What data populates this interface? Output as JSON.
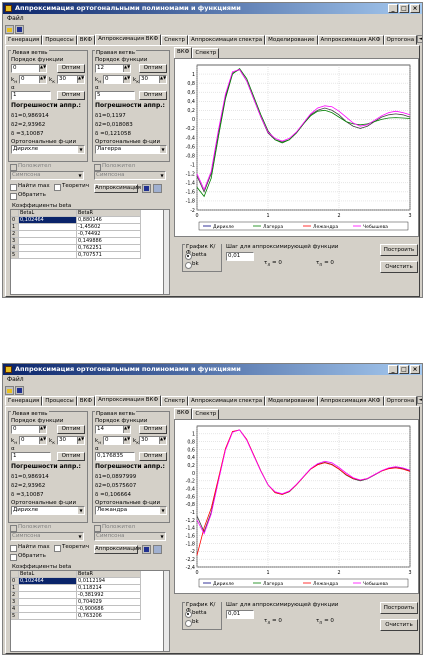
{
  "app": {
    "title": "Аппроксимация ортогональными полиномами и функциями"
  },
  "menu": {
    "file": "Файл"
  },
  "tabs": [
    "Генерация",
    "Процессы",
    "ВКФ",
    "Аппроксимация ВКФ",
    "Спектр",
    "Аппроксимация спектра",
    "Моделирование",
    "Аппроксимация АКФ",
    "Ортогона"
  ],
  "active_tab_index": 3,
  "sub_tabs": [
    "ВКФ",
    "Спектр"
  ],
  "left_branch": {
    "title": "Левая ветвь",
    "order_label": "Порядок функции",
    "order": "0",
    "opt_button": "Оптим",
    "kn_label": "k",
    "kn_sub": "н",
    "kn": "0",
    "kk_label": "k",
    "kk_sub": "к",
    "kk": "30",
    "alpha_label": "α",
    "alpha": "1",
    "errors_label": "Погрешности аппр.:",
    "d1": "δ1=0,986914",
    "d2": "δ2=2,93962",
    "d": "δ =3,10087",
    "orth_label": "Ортогональные ф-ции",
    "orth_value": "Дирихле",
    "positive_label": "Положител",
    "simpson": "Симпсона"
  },
  "right_branch": {
    "title": "Правая ветвь",
    "order_label": "Порядок функции",
    "opt_button": "Оптим",
    "kn": "0",
    "kk": "30",
    "alpha_label": "α",
    "positive_label": "Положител",
    "simpson": "Симпсона"
  },
  "controls": {
    "find_max": "Найти max",
    "theoretical": "Теоретич",
    "invert": "Обратить",
    "approx_button": "Аппроксимация",
    "coeffs_label": "Коэффициенты beta",
    "col_betaL": "BetaL",
    "col_betaR": "BetaR"
  },
  "bottom": {
    "graph_label": "График К/Ф",
    "radio_beta": "betta",
    "radio_bk": "bk",
    "step_label": "Шаг для аппроксимирующей функции",
    "step_value": "0,01",
    "tau_left": "τ",
    "tau_left_sub": "л",
    "tau_left_val": "= 0",
    "tau_right": "τ",
    "tau_right_sub": "п",
    "tau_right_val": "= 0",
    "build_button": "Построить",
    "clear_button": "Очистить"
  },
  "windows": [
    {
      "right_order": "12",
      "right_alpha": "5",
      "right_d1": "δ1=0,1197",
      "right_d2": "δ2=0,018083",
      "right_d": "δ =0,121058",
      "right_orth": "Лагерра",
      "rows": [
        [
          "0",
          "0,102464",
          "0,880146"
        ],
        [
          "1",
          "",
          "-1,45602"
        ],
        [
          "2",
          "",
          "-0,74492"
        ],
        [
          "3",
          "",
          "0,149886"
        ],
        [
          "4",
          "",
          "0,762251"
        ],
        [
          "5",
          "",
          "0,707571"
        ]
      ],
      "chart_data": {
        "type": "line",
        "xlim": [
          0,
          3
        ],
        "ylim": [
          -2,
          1.2
        ],
        "xticks": [
          "0",
          "1",
          "2",
          "3"
        ],
        "yticks": [
          "1",
          "0,8",
          "0,6",
          "0,4",
          "0,2",
          "0",
          "-0,2",
          "-0,4",
          "-0,6",
          "-0,8",
          "-1",
          "-1,2",
          "-1,4",
          "-1,6",
          "-1,8",
          "-2"
        ],
        "legend": [
          "Дирихле",
          "Лагерра",
          "Лежандра",
          "Чебышева"
        ],
        "legend_colors": [
          "#000080",
          "#008000",
          "#ff0000",
          "#ff00ff"
        ],
        "series": [
          {
            "name": "Дирихле",
            "color": "#404040",
            "x": [
              0,
              0.1,
              0.2,
              0.3,
              0.4,
              0.5,
              0.6,
              0.7,
              0.8,
              0.9,
              1.0,
              1.1,
              1.2,
              1.3,
              1.4,
              1.5,
              1.6,
              1.7,
              1.8,
              1.9,
              2.0,
              2.1,
              2.2,
              2.3,
              2.4,
              2.5,
              2.6,
              2.7,
              2.8,
              2.9,
              3.0
            ],
            "y": [
              -1.25,
              -1.6,
              -1.2,
              -0.3,
              0.5,
              1.02,
              1.1,
              0.85,
              0.45,
              0.05,
              -0.3,
              -0.45,
              -0.5,
              -0.45,
              -0.3,
              -0.1,
              0.1,
              0.2,
              0.25,
              0.2,
              0.1,
              -0.05,
              -0.15,
              -0.2,
              -0.15,
              -0.05,
              0.05,
              0.1,
              0.12,
              0.1,
              0.05
            ]
          },
          {
            "name": "Лагерра",
            "color": "#008000",
            "x": [
              0,
              0.1,
              0.2,
              0.3,
              0.4,
              0.5,
              0.6,
              0.7,
              0.8,
              0.9,
              1.0,
              1.1,
              1.2,
              1.3,
              1.4,
              1.5,
              1.6,
              1.7,
              1.8,
              1.9,
              2.0,
              2.1,
              2.2,
              2.3,
              2.4,
              2.5,
              2.6,
              2.7,
              2.8,
              2.9,
              3.0
            ],
            "y": [
              -1.5,
              -1.7,
              -1.3,
              -0.4,
              0.45,
              1.0,
              1.12,
              0.9,
              0.5,
              0.1,
              -0.25,
              -0.45,
              -0.52,
              -0.45,
              -0.3,
              -0.1,
              0.08,
              0.18,
              0.2,
              0.15,
              0.05,
              -0.05,
              -0.1,
              -0.12,
              -0.1,
              -0.05,
              0.0,
              0.03,
              0.04,
              0.03,
              0.02
            ]
          },
          {
            "name": "Чебышева",
            "color": "#ff00ff",
            "x": [
              0,
              0.1,
              0.2,
              0.3,
              0.4,
              0.5,
              0.6,
              0.7,
              0.8,
              0.9,
              1.0,
              1.1,
              1.2,
              1.3,
              1.4,
              1.5,
              1.6,
              1.7,
              1.8,
              1.9,
              2.0,
              2.1,
              2.2,
              2.3,
              2.4,
              2.5,
              2.6,
              2.7,
              2.8,
              2.9,
              3.0
            ],
            "y": [
              -1.2,
              -1.55,
              -1.15,
              -0.25,
              0.55,
              1.05,
              1.1,
              0.85,
              0.45,
              0.05,
              -0.28,
              -0.42,
              -0.48,
              -0.42,
              -0.28,
              -0.08,
              0.12,
              0.25,
              0.3,
              0.28,
              0.18,
              0.05,
              -0.08,
              -0.15,
              -0.12,
              -0.02,
              0.08,
              0.15,
              0.18,
              0.15,
              0.1
            ]
          }
        ]
      }
    },
    {
      "right_order": "14",
      "right_alpha": "0,176835",
      "right_d1": "δ1=0,0897999",
      "right_d2": "δ2=0,0575607",
      "right_d": "δ =0,106664",
      "right_orth": "Лежандра",
      "rows": [
        [
          "0",
          "0,102464",
          "0,0112194"
        ],
        [
          "1",
          "",
          "0,118214"
        ],
        [
          "2",
          "",
          "-0,381992"
        ],
        [
          "3",
          "",
          "0,704029"
        ],
        [
          "4",
          "",
          "-0,900686"
        ],
        [
          "5",
          "",
          "0,763206"
        ]
      ],
      "chart_data": {
        "type": "line",
        "xlim": [
          0,
          3
        ],
        "ylim": [
          -2.4,
          1.2
        ],
        "xticks": [
          "0",
          "1",
          "2",
          "3"
        ],
        "yticks": [
          "1",
          "0,8",
          "0,6",
          "0,4",
          "0,2",
          "0",
          "-0,2",
          "-0,4",
          "-0,6",
          "-0,8",
          "-1",
          "-1,2",
          "-1,4",
          "-1,6",
          "-1,8",
          "-2",
          "-2,2",
          "-2,4"
        ],
        "legend": [
          "Дирихле",
          "Лагерра",
          "Лежандра",
          "Чебышева"
        ],
        "legend_colors": [
          "#000080",
          "#008000",
          "#ff0000",
          "#ff00ff"
        ],
        "series": [
          {
            "name": "Дирихле",
            "color": "#404040",
            "x": [
              0,
              0.1,
              0.2,
              0.3,
              0.4,
              0.5,
              0.6,
              0.7,
              0.8,
              0.9,
              1.0,
              1.1,
              1.2,
              1.3,
              1.4,
              1.5,
              1.6,
              1.7,
              1.8,
              1.9,
              2.0,
              2.1,
              2.2,
              2.3,
              2.4,
              2.5,
              2.6,
              2.7,
              2.8,
              2.9,
              3.0
            ],
            "y": [
              -1.1,
              -1.5,
              -1.0,
              -0.2,
              0.6,
              1.05,
              1.1,
              0.85,
              0.45,
              0.05,
              -0.3,
              -0.5,
              -0.55,
              -0.48,
              -0.3,
              -0.1,
              0.1,
              0.22,
              0.27,
              0.22,
              0.1,
              -0.05,
              -0.15,
              -0.2,
              -0.15,
              -0.05,
              0.05,
              0.12,
              0.15,
              0.12,
              0.05
            ]
          },
          {
            "name": "Лежандра",
            "color": "#ff0000",
            "x": [
              0,
              0.1,
              0.2,
              0.3,
              0.4,
              0.5,
              0.6,
              0.7,
              0.8,
              0.9,
              1.0,
              1.1,
              1.2,
              1.3,
              1.4,
              1.5,
              1.6,
              1.7,
              1.8,
              1.9,
              2.0,
              2.1,
              2.2,
              2.3,
              2.4,
              2.5,
              2.6,
              2.7,
              2.8,
              2.9,
              3.0
            ],
            "y": [
              -2.1,
              -1.4,
              -0.9,
              -0.15,
              0.62,
              1.06,
              1.1,
              0.86,
              0.46,
              0.05,
              -0.3,
              -0.5,
              -0.55,
              -0.47,
              -0.3,
              -0.1,
              0.1,
              0.21,
              0.26,
              0.21,
              0.1,
              -0.04,
              -0.14,
              -0.18,
              -0.14,
              -0.04,
              0.05,
              0.11,
              0.13,
              0.1,
              0.04
            ]
          },
          {
            "name": "Чебышева",
            "color": "#ff00ff",
            "x": [
              0,
              0.1,
              0.2,
              0.3,
              0.4,
              0.5,
              0.6,
              0.7,
              0.8,
              0.9,
              1.0,
              1.1,
              1.2,
              1.3,
              1.4,
              1.5,
              1.6,
              1.7,
              1.8,
              1.9,
              2.0,
              2.1,
              2.2,
              2.3,
              2.4,
              2.5,
              2.6,
              2.7,
              2.8,
              2.9,
              3.0
            ],
            "y": [
              -1.2,
              -1.55,
              -1.05,
              -0.22,
              0.58,
              1.04,
              1.1,
              0.84,
              0.44,
              0.04,
              -0.3,
              -0.48,
              -0.53,
              -0.46,
              -0.29,
              -0.09,
              0.11,
              0.24,
              0.3,
              0.26,
              0.14,
              0.0,
              -0.12,
              -0.18,
              -0.14,
              -0.04,
              0.06,
              0.13,
              0.16,
              0.13,
              0.07
            ]
          }
        ]
      }
    }
  ]
}
